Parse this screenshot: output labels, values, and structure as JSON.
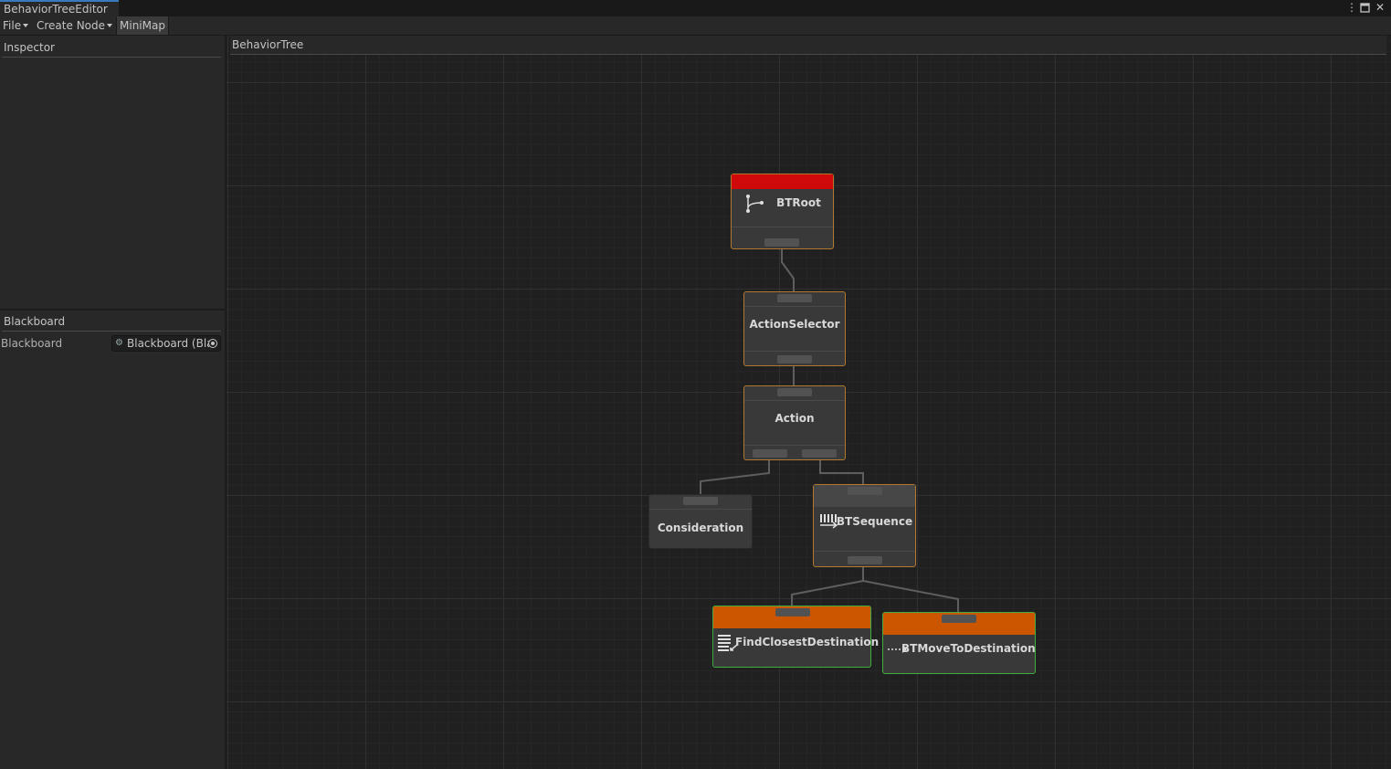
{
  "window": {
    "title": "BehaviorTreeEditor",
    "controls": {
      "more": "⋮",
      "maximize": "🗖",
      "close": "✕"
    }
  },
  "menubar": {
    "file": "File",
    "create_node": "Create Node",
    "minimap": "MiniMap"
  },
  "inspector": {
    "header": "Inspector"
  },
  "blackboard": {
    "header": "Blackboard",
    "field_label": "Blackboard",
    "field_value": "Blackboard (Bla"
  },
  "graph": {
    "header": "BehaviorTree",
    "nodes": {
      "root": {
        "title": "BTRoot",
        "band_color": "#d00a0a",
        "icon": "branch-icon"
      },
      "action_selector": {
        "title": "ActionSelector"
      },
      "action": {
        "title": "Action"
      },
      "consideration": {
        "title": "Consideration"
      },
      "sequence": {
        "title": "BTSequence",
        "icon": "sequence-icon"
      },
      "find_closest": {
        "title": "FindClosestDestination",
        "band_color": "#cc5500",
        "icon": "list-icon"
      },
      "move_to": {
        "title": "BTMoveToDestination",
        "band_color": "#cc5500",
        "icon": "dotted-arrow-icon"
      }
    }
  },
  "colors": {
    "node_border_default": "#b0792c",
    "node_border_running": "#3fae3f",
    "tab_accent": "#3a79bb"
  }
}
